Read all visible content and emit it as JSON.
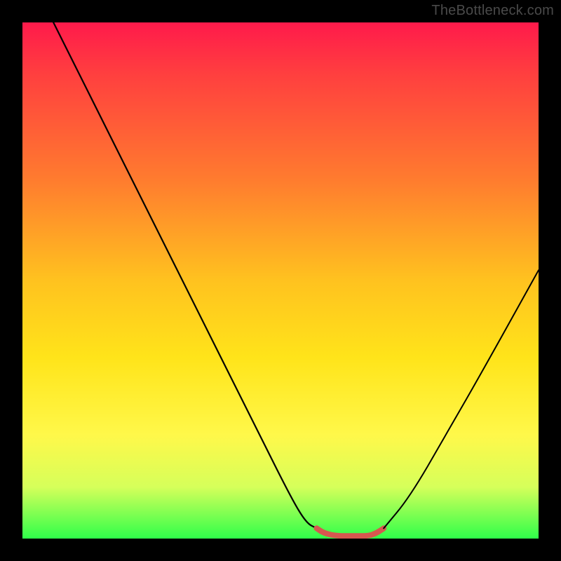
{
  "watermark": "TheBottleneck.com",
  "chart_data": {
    "type": "line",
    "title": "",
    "xlabel": "",
    "ylabel": "",
    "xlim": [
      0,
      100
    ],
    "ylim": [
      0,
      100
    ],
    "grid": false,
    "series": [
      {
        "name": "left-curve",
        "x": [
          6,
          15,
          25,
          35,
          45,
          52,
          55,
          57
        ],
        "y": [
          100,
          82,
          62,
          42,
          22,
          8,
          3,
          2
        ],
        "stroke": "#000000",
        "width": 2.2
      },
      {
        "name": "valley-highlight",
        "x": [
          57,
          58.5,
          61,
          64,
          67,
          68.5,
          70
        ],
        "y": [
          2,
          1,
          0.5,
          0.5,
          0.5,
          1,
          2
        ],
        "stroke": "#d6574f",
        "width": 8
      },
      {
        "name": "right-curve",
        "x": [
          70,
          75,
          82,
          90,
          100
        ],
        "y": [
          2,
          8,
          20,
          34,
          52
        ],
        "stroke": "#000000",
        "width": 2
      }
    ],
    "colors": {
      "gradient_top": "#ff1a4b",
      "gradient_mid": "#ffe41a",
      "gradient_bottom": "#2fff4a",
      "highlight": "#d6574f"
    }
  }
}
